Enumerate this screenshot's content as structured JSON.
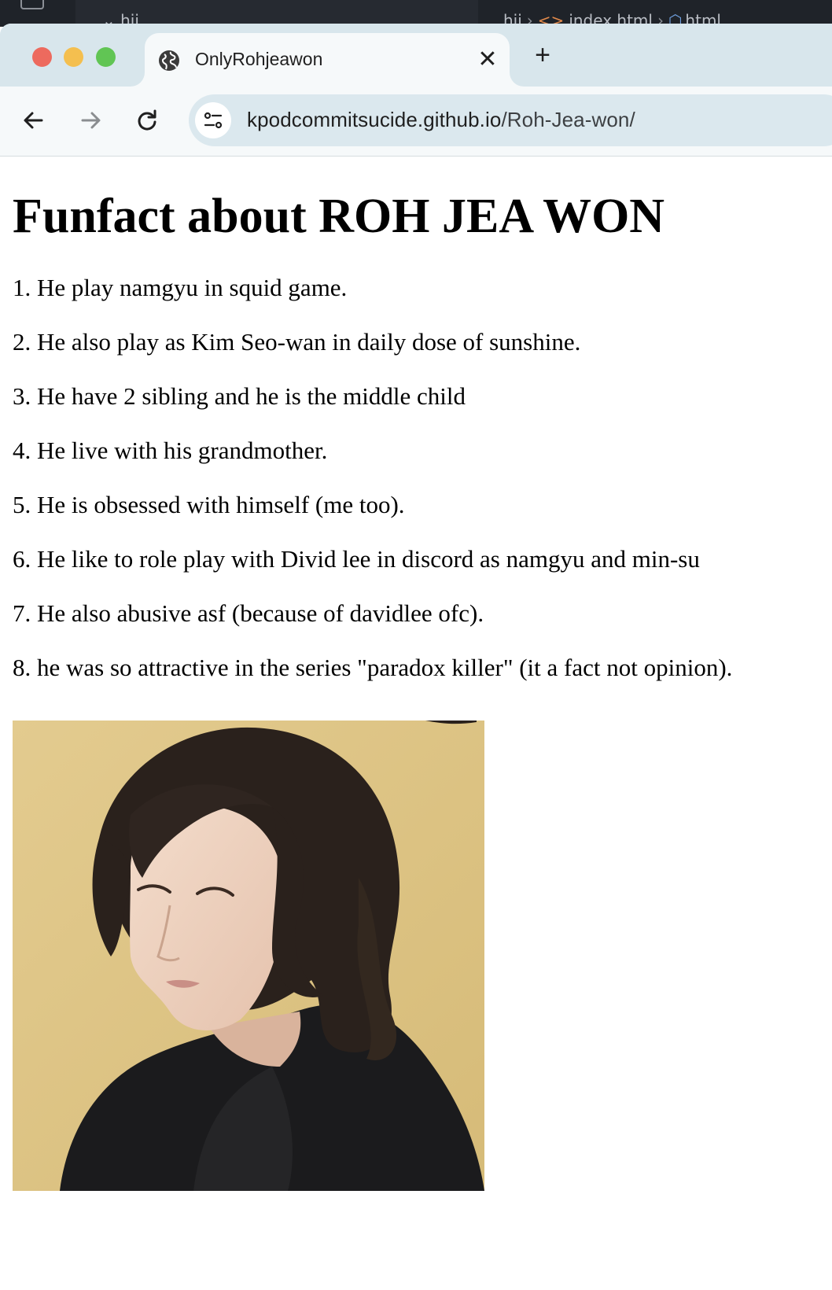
{
  "editor": {
    "left_text": "⌄ hii",
    "crumbs": [
      "hii",
      "index.html",
      "html"
    ]
  },
  "browser": {
    "tab": {
      "title": "OnlyRohjeawon",
      "close_label": "✕"
    },
    "new_tab_label": "+",
    "url": {
      "host": "kpodcommitsucide.github.io",
      "path": "/Roh-Jea-won/"
    }
  },
  "page": {
    "heading": "Funfact about ROH JEA WON",
    "facts": [
      "1. He play namgyu in squid game.",
      "2. He also play as Kim Seo-wan in daily dose of sunshine.",
      "3. He have 2 sibling and he is the middle child",
      "4. He live with his grandmother.",
      "5. He is obsessed with himself (me too).",
      "6. He like to role play with Divid lee in discord as namgyu and min-su",
      "7. He also abusive asf (because of davidlee ofc).",
      "8. he was so attractive in the series \"paradox killer\" (it a fact not opinion)."
    ]
  },
  "colors": {
    "tabstrip": "#d8e6ec",
    "toolbar": "#f6f9fa",
    "omnibox": "#dbe8ee",
    "photo_background": "#dcc387"
  },
  "icons": [
    "globe-icon",
    "close-icon",
    "plus-icon",
    "back-arrow-icon",
    "forward-arrow-icon",
    "reload-icon",
    "site-settings-icon"
  ]
}
